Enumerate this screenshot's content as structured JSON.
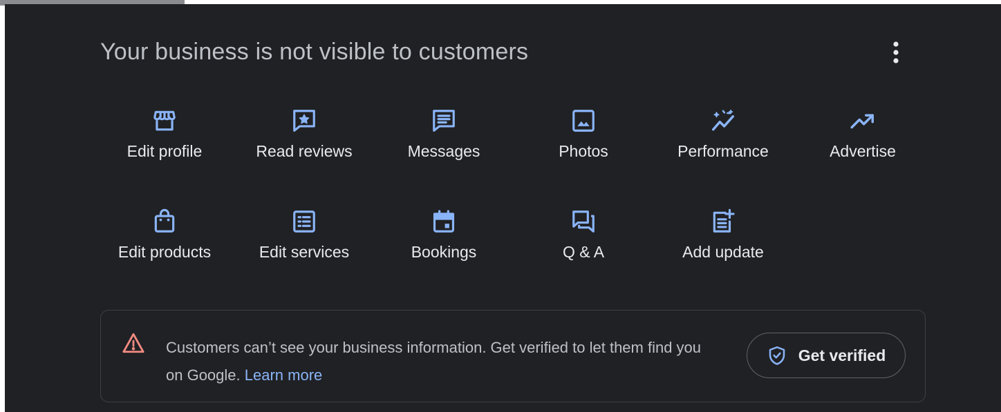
{
  "header": {
    "title": "Your business is not visible to customers",
    "more_icon": "more-vert-icon"
  },
  "actions": [
    {
      "label": "Edit profile",
      "icon": "storefront-icon"
    },
    {
      "label": "Read reviews",
      "icon": "review-star-icon"
    },
    {
      "label": "Messages",
      "icon": "message-icon"
    },
    {
      "label": "Photos",
      "icon": "photo-icon"
    },
    {
      "label": "Performance",
      "icon": "performance-icon"
    },
    {
      "label": "Advertise",
      "icon": "trending-up-icon"
    },
    {
      "label": "Edit products",
      "icon": "shopping-bag-icon"
    },
    {
      "label": "Edit services",
      "icon": "list-icon"
    },
    {
      "label": "Bookings",
      "icon": "calendar-icon"
    },
    {
      "label": "Q & A",
      "icon": "forum-icon"
    },
    {
      "label": "Add update",
      "icon": "post-add-icon"
    }
  ],
  "banner": {
    "message": "Customers can’t see your business information. Get verified to let them find you on Google.",
    "link": "Learn more",
    "button_label": "Get verified",
    "warning_icon": "warning-icon",
    "button_icon": "verified-shield-icon"
  },
  "colors": {
    "background": "#202124",
    "accent": "#8ab4f8",
    "warning": "#f28b82",
    "text": "#e8eaed",
    "muted": "#bdc1c6"
  }
}
